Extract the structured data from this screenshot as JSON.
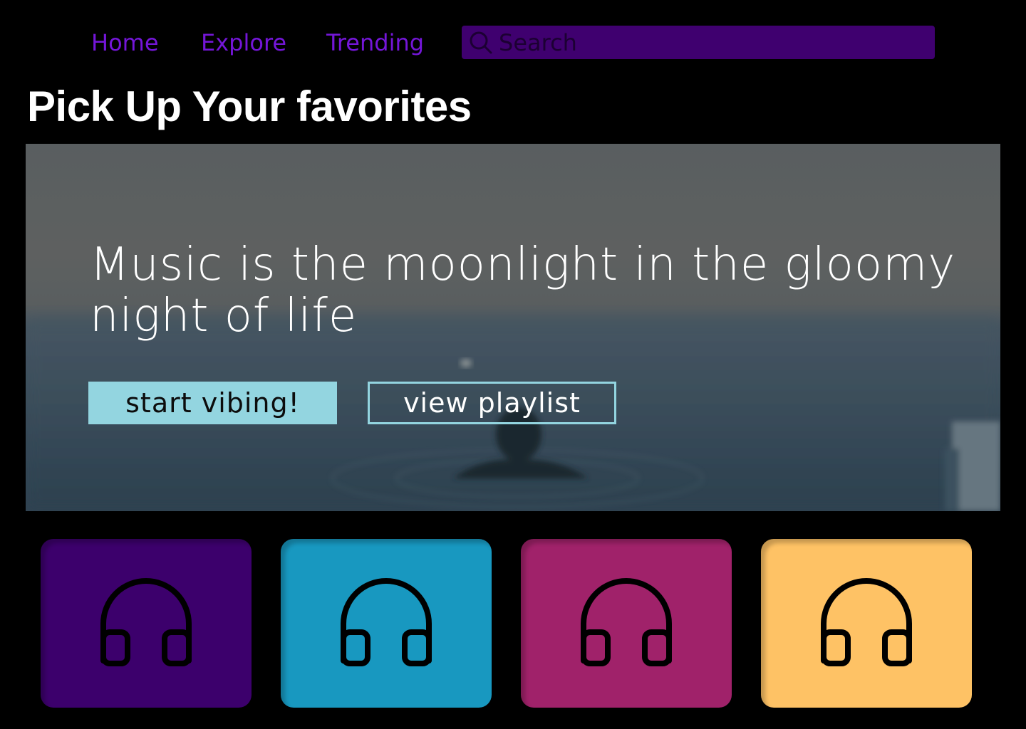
{
  "nav": {
    "links": [
      {
        "label": "Home"
      },
      {
        "label": "Explore"
      },
      {
        "label": "Trending"
      }
    ],
    "link_color": "#7416d8",
    "search": {
      "placeholder": "Search",
      "background": "#3f006f",
      "icon": "search-icon"
    }
  },
  "page": {
    "title": "Pick Up Your favorites"
  },
  "hero": {
    "quote": "Music is the moonlight in the gloomy night of life",
    "primary_button": "start vibing!",
    "secondary_button": "view playlist",
    "accent": "#93d5e0"
  },
  "cards": [
    {
      "color": "#3c006c",
      "icon": "headphones-icon"
    },
    {
      "color": "#1898c0",
      "icon": "headphones-icon"
    },
    {
      "color": "#a0226a",
      "icon": "headphones-icon"
    },
    {
      "color": "#fec265",
      "icon": "headphones-icon"
    }
  ]
}
